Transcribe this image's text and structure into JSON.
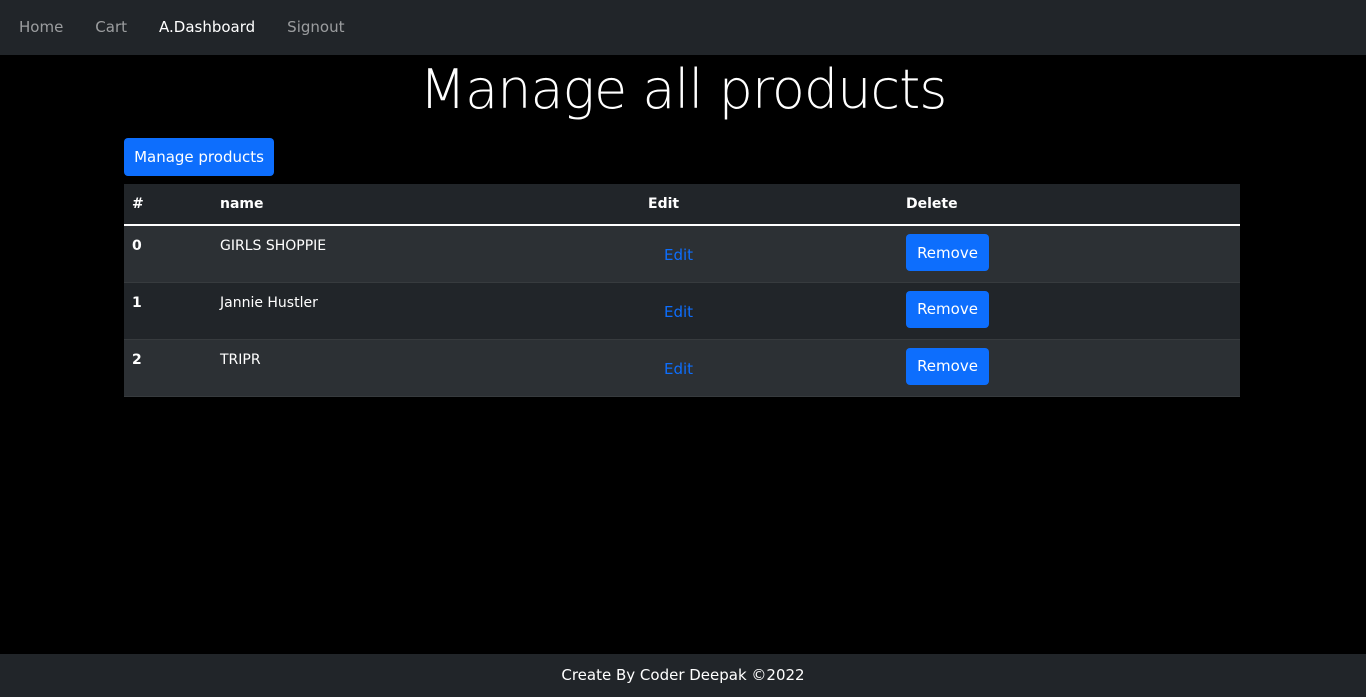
{
  "nav": {
    "items": [
      {
        "label": "Home",
        "active": false
      },
      {
        "label": "Cart",
        "active": false
      },
      {
        "label": "A.Dashboard",
        "active": true
      },
      {
        "label": "Signout",
        "active": false
      }
    ]
  },
  "page": {
    "title": "Manage all products",
    "manage_button_label": "Manage products"
  },
  "table": {
    "headers": [
      "#",
      "name",
      "Edit",
      "Delete"
    ],
    "rows": [
      {
        "index": "0",
        "name": "GIRLS SHOPPIE",
        "edit_label": "Edit",
        "remove_label": "Remove"
      },
      {
        "index": "1",
        "name": "Jannie Hustler",
        "edit_label": "Edit",
        "remove_label": "Remove"
      },
      {
        "index": "2",
        "name": "TRIPR",
        "edit_label": "Edit",
        "remove_label": "Remove"
      }
    ]
  },
  "footer": {
    "text": "Create By Coder Deepak ©2022"
  },
  "colors": {
    "background": "#000000",
    "navbar": "#212529",
    "accent": "#0d6efd"
  }
}
